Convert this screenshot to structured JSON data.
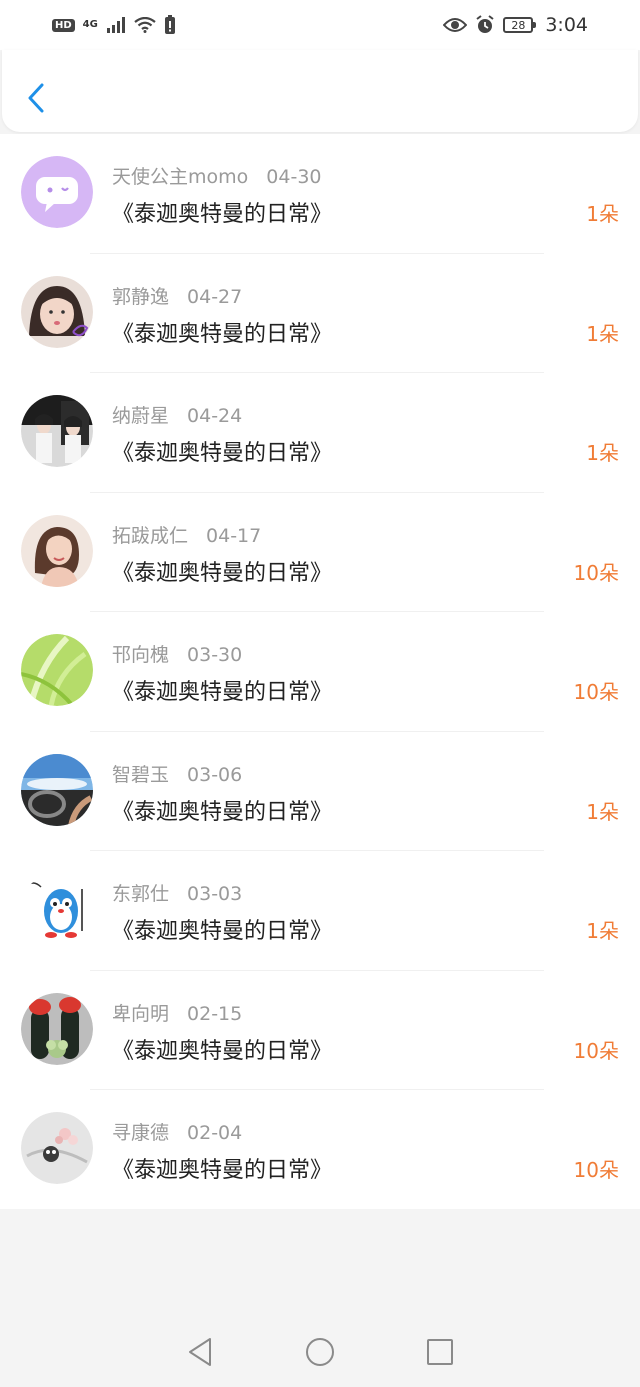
{
  "status": {
    "hd": "HD",
    "network": "4G",
    "battery": "28",
    "time": "3:04"
  },
  "items": [
    {
      "name": "天使公主momo",
      "date": "04-30",
      "title": "《泰迦奥特曼的日常》",
      "amount": "1朵"
    },
    {
      "name": "郭静逸",
      "date": "04-27",
      "title": "《泰迦奥特曼的日常》",
      "amount": "1朵"
    },
    {
      "name": "纳蔚星",
      "date": "04-24",
      "title": "《泰迦奥特曼的日常》",
      "amount": "1朵"
    },
    {
      "name": "拓跋成仁",
      "date": "04-17",
      "title": "《泰迦奥特曼的日常》",
      "amount": "10朵"
    },
    {
      "name": "邗向槐",
      "date": "03-30",
      "title": "《泰迦奥特曼的日常》",
      "amount": "10朵"
    },
    {
      "name": "智碧玉",
      "date": "03-06",
      "title": "《泰迦奥特曼的日常》",
      "amount": "1朵"
    },
    {
      "name": "东郭仕",
      "date": "03-03",
      "title": "《泰迦奥特曼的日常》",
      "amount": "1朵"
    },
    {
      "name": "卑向明",
      "date": "02-15",
      "title": "《泰迦奥特曼的日常》",
      "amount": "10朵"
    },
    {
      "name": "寻康德",
      "date": "02-04",
      "title": "《泰迦奥特曼的日常》",
      "amount": "10朵"
    }
  ],
  "colors": {
    "accent": "#1e90e8",
    "amount": "#f07c36"
  },
  "icons": {
    "back": "chevron-left-icon",
    "nav": [
      "back-triangle-icon",
      "home-circle-icon",
      "recents-square-icon"
    ]
  }
}
